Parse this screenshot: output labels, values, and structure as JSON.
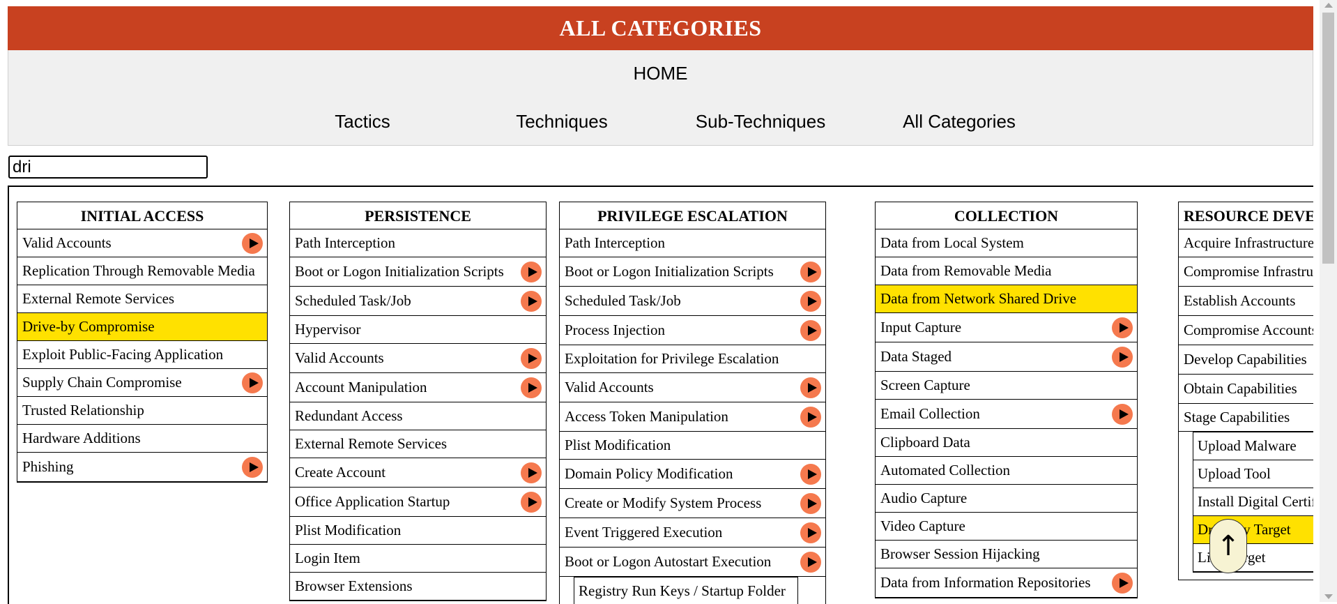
{
  "header": {
    "title": "ALL CATEGORIES"
  },
  "nav": {
    "home": "HOME",
    "links": [
      "Tactics",
      "Techniques",
      "Sub-Techniques",
      "All Categories"
    ]
  },
  "search": {
    "value": "dri"
  },
  "columns": [
    {
      "title": "INITIAL ACCESS",
      "items": [
        {
          "label": "Valid Accounts",
          "expand": true
        },
        {
          "label": "Replication Through Removable Media"
        },
        {
          "label": "External Remote Services"
        },
        {
          "label": "Drive-by Compromise",
          "highlight": true
        },
        {
          "label": "Exploit Public-Facing Application"
        },
        {
          "label": "Supply Chain Compromise",
          "expand": true
        },
        {
          "label": "Trusted Relationship"
        },
        {
          "label": "Hardware Additions"
        },
        {
          "label": "Phishing",
          "expand": true
        }
      ]
    },
    {
      "title": "PERSISTENCE",
      "items": [
        {
          "label": "Path Interception"
        },
        {
          "label": "Boot or Logon Initialization Scripts",
          "expand": true
        },
        {
          "label": "Scheduled Task/Job",
          "expand": true
        },
        {
          "label": "Hypervisor"
        },
        {
          "label": "Valid Accounts",
          "expand": true
        },
        {
          "label": "Account Manipulation",
          "expand": true
        },
        {
          "label": "Redundant Access"
        },
        {
          "label": "External Remote Services"
        },
        {
          "label": "Create Account",
          "expand": true
        },
        {
          "label": "Office Application Startup",
          "expand": true
        },
        {
          "label": "Plist Modification"
        },
        {
          "label": "Login Item"
        },
        {
          "label": "Browser Extensions"
        }
      ]
    },
    {
      "title": "PRIVILEGE ESCALATION",
      "items": [
        {
          "label": "Path Interception"
        },
        {
          "label": "Boot or Logon Initialization Scripts",
          "expand": true
        },
        {
          "label": "Scheduled Task/Job",
          "expand": true
        },
        {
          "label": "Process Injection",
          "expand": true
        },
        {
          "label": "Exploitation for Privilege Escalation"
        },
        {
          "label": "Valid Accounts",
          "expand": true
        },
        {
          "label": "Access Token Manipulation",
          "expand": true
        },
        {
          "label": "Plist Modification"
        },
        {
          "label": "Domain Policy Modification",
          "expand": true
        },
        {
          "label": "Create or Modify System Process",
          "expand": true
        },
        {
          "label": "Event Triggered Execution",
          "expand": true
        },
        {
          "label": "Boot or Logon Autostart Execution",
          "expand": true
        }
      ],
      "sub_items": [
        {
          "label": "Registry Run Keys / Startup Folder"
        }
      ]
    },
    {
      "title": "COLLECTION",
      "items": [
        {
          "label": "Data from Local System"
        },
        {
          "label": "Data from Removable Media"
        },
        {
          "label": "Data from Network Shared Drive",
          "highlight": true
        },
        {
          "label": "Input Capture",
          "expand": true
        },
        {
          "label": "Data Staged",
          "expand": true
        },
        {
          "label": "Screen Capture"
        },
        {
          "label": "Email Collection",
          "expand": true
        },
        {
          "label": "Clipboard Data"
        },
        {
          "label": "Automated Collection"
        },
        {
          "label": "Audio Capture"
        },
        {
          "label": "Video Capture"
        },
        {
          "label": "Browser Session Hijacking"
        },
        {
          "label": "Data from Information Repositories",
          "expand": true
        }
      ]
    },
    {
      "title": "RESOURCE DEVELOPMENT",
      "items": [
        {
          "label": "Acquire Infrastructure"
        },
        {
          "label": "Compromise Infrastructure"
        },
        {
          "label": "Establish Accounts"
        },
        {
          "label": "Compromise Accounts"
        },
        {
          "label": "Develop Capabilities"
        },
        {
          "label": "Obtain Capabilities"
        },
        {
          "label": "Stage Capabilities"
        }
      ],
      "sub_items": [
        {
          "label": "Upload Malware"
        },
        {
          "label": "Upload Tool"
        },
        {
          "label": "Install Digital Certificate"
        },
        {
          "label": "Drive-by Target",
          "highlight": true
        },
        {
          "label": "Link Target"
        }
      ]
    }
  ],
  "scroll_top": {
    "icon": "up-arrow-icon",
    "glyph": "↑"
  },
  "colors": {
    "header": "#c84120",
    "highlight": "#ffe100",
    "expand_button": "#f5794e"
  }
}
